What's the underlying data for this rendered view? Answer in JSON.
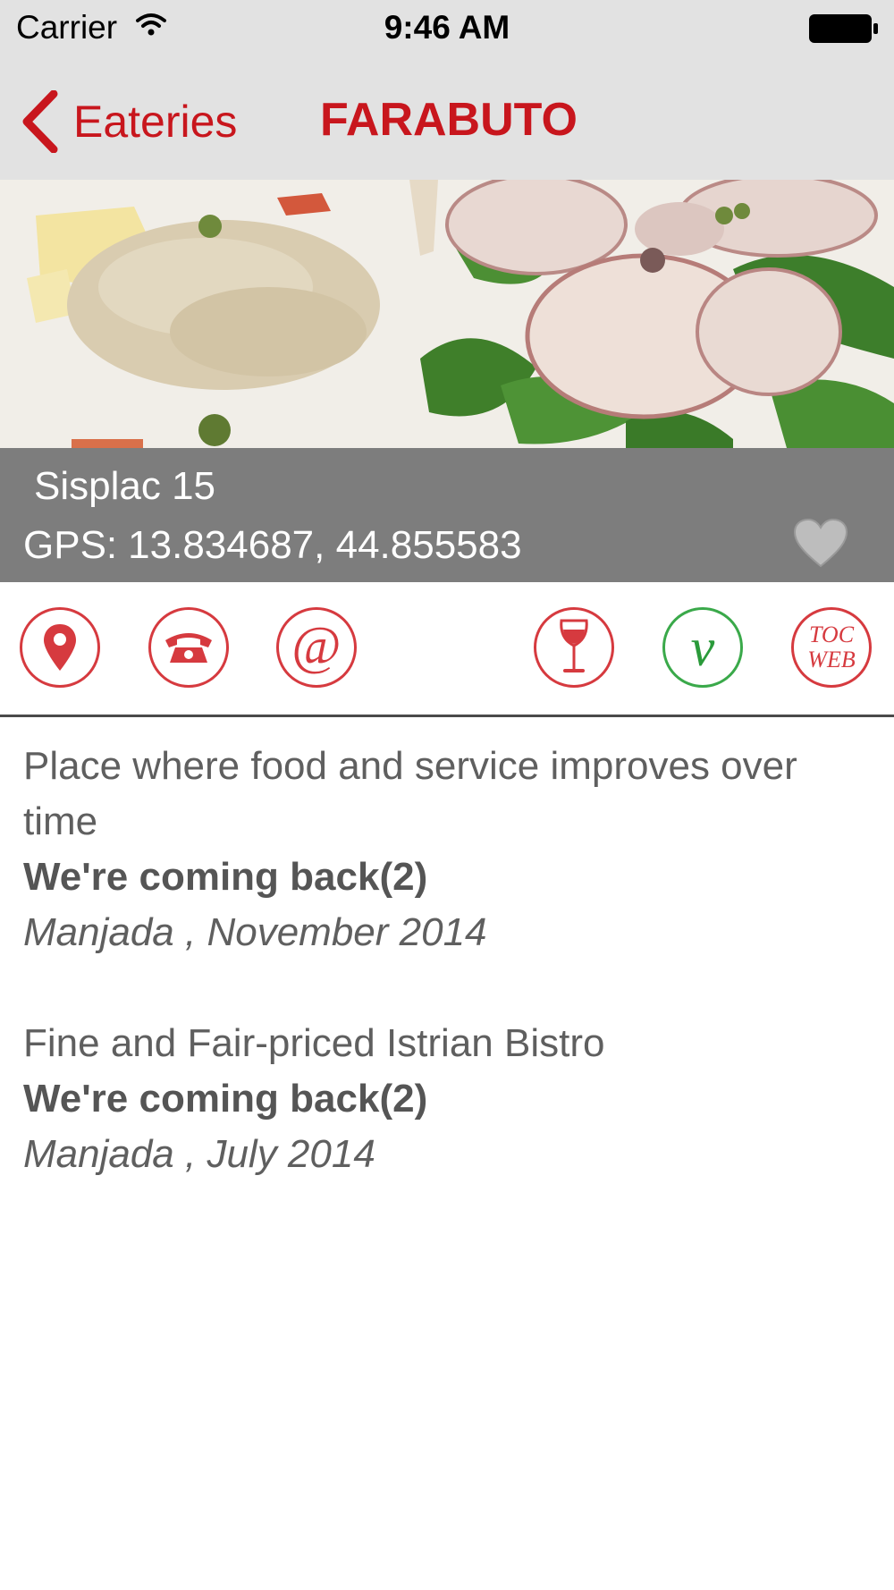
{
  "status_bar": {
    "carrier": "Carrier",
    "time": "9:46 AM"
  },
  "nav": {
    "back_label": "Eateries",
    "title": "FARABUTO"
  },
  "venue": {
    "address": "Sisplac 15",
    "gps_prefix": "GPS:",
    "gps_coords": "13.834687, 44.855583",
    "favorite": false
  },
  "actions": {
    "map_icon": "map-pin-icon",
    "phone_icon": "phone-icon",
    "email_icon": "at-sign-icon",
    "wine_icon": "wine-glass-icon",
    "veg_icon": "vegetarian-v-icon",
    "toc_web_line1": "TOC",
    "toc_web_line2": "WEB"
  },
  "colors": {
    "accent": "#c8161d",
    "icon_red": "#d63a3f",
    "icon_green": "#3aa94a",
    "band": "#7d7d7d"
  },
  "reviews": [
    {
      "text": "Place where food and service improves over time",
      "verdict": "We're coming back(2)",
      "meta": "Manjada , November 2014"
    },
    {
      "text": "Fine and Fair-priced Istrian Bistro",
      "verdict": "We're coming back(2)",
      "meta": "Manjada , July 2014"
    }
  ]
}
